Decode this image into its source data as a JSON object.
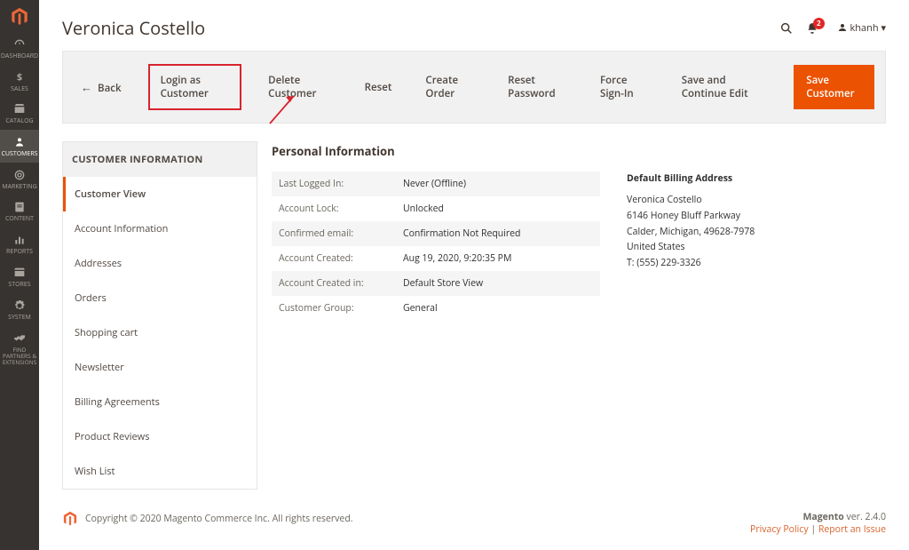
{
  "sidenav": {
    "items": [
      {
        "label": "DASHBOARD",
        "icon": "dashboard"
      },
      {
        "label": "SALES",
        "icon": "sales"
      },
      {
        "label": "CATALOG",
        "icon": "catalog"
      },
      {
        "label": "CUSTOMERS",
        "icon": "customers",
        "active": true
      },
      {
        "label": "MARKETING",
        "icon": "marketing"
      },
      {
        "label": "CONTENT",
        "icon": "content"
      },
      {
        "label": "REPORTS",
        "icon": "reports"
      },
      {
        "label": "STORES",
        "icon": "stores"
      },
      {
        "label": "SYSTEM",
        "icon": "system"
      },
      {
        "label": "FIND PARTNERS & EXTENSIONS",
        "icon": "partners",
        "small": true
      }
    ]
  },
  "header": {
    "title": "Veronica Costello",
    "notify_count": "2",
    "user": "khanh"
  },
  "toolbar": {
    "back": "Back",
    "login": "Login as Customer",
    "delete": "Delete Customer",
    "reset": "Reset",
    "create_order": "Create Order",
    "reset_password": "Reset Password",
    "force_signin": "Force Sign-In",
    "save_continue": "Save and Continue Edit",
    "save": "Save Customer"
  },
  "panel": {
    "header": "CUSTOMER INFORMATION",
    "items": [
      "Customer View",
      "Account Information",
      "Addresses",
      "Orders",
      "Shopping cart",
      "Newsletter",
      "Billing Agreements",
      "Product Reviews",
      "Wish List"
    ]
  },
  "section": {
    "title": "Personal Information",
    "rows": [
      {
        "k": "Last Logged In:",
        "v": "Never (Offline)"
      },
      {
        "k": "Account Lock:",
        "v": "Unlocked"
      },
      {
        "k": "Confirmed email:",
        "v": "Confirmation Not Required"
      },
      {
        "k": "Account Created:",
        "v": "Aug 19, 2020, 9:20:35 PM"
      },
      {
        "k": "Account Created in:",
        "v": "Default Store View"
      },
      {
        "k": "Customer Group:",
        "v": "General"
      }
    ],
    "billing": {
      "heading": "Default Billing Address",
      "name": "Veronica Costello",
      "street": "6146 Honey Bluff Parkway",
      "city": "Calder, Michigan, 49628-7978",
      "country": "United States",
      "phone": "T: (555) 229-3326"
    }
  },
  "footer": {
    "copyright": "Copyright © 2020 Magento Commerce Inc. All rights reserved.",
    "product_line": "Magento",
    "version": " ver. 2.4.0",
    "privacy": "Privacy Policy",
    "sep": " | ",
    "report": "Report an Issue"
  }
}
